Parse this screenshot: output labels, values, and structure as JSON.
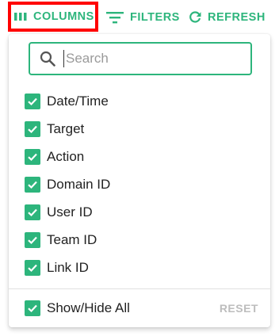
{
  "toolbar": {
    "columns_label": "COLUMNS",
    "filters_label": "FILTERS",
    "refresh_label": "REFRESH",
    "columns_icon": "view-column-icon",
    "filters_icon": "filter-list-icon",
    "refresh_icon": "refresh-icon",
    "accent_color": "#2db57c",
    "highlight_color": "#ff0000"
  },
  "panel": {
    "search": {
      "placeholder": "Search",
      "value": "",
      "icon": "search-icon"
    },
    "columns": [
      {
        "label": "Date/Time",
        "checked": true
      },
      {
        "label": "Target",
        "checked": true
      },
      {
        "label": "Action",
        "checked": true
      },
      {
        "label": "Domain ID",
        "checked": true
      },
      {
        "label": "User ID",
        "checked": true
      },
      {
        "label": "Team ID",
        "checked": true
      },
      {
        "label": "Link ID",
        "checked": true
      }
    ],
    "footer": {
      "show_hide_label": "Show/Hide All",
      "show_hide_checked": true,
      "reset_label": "RESET"
    }
  }
}
